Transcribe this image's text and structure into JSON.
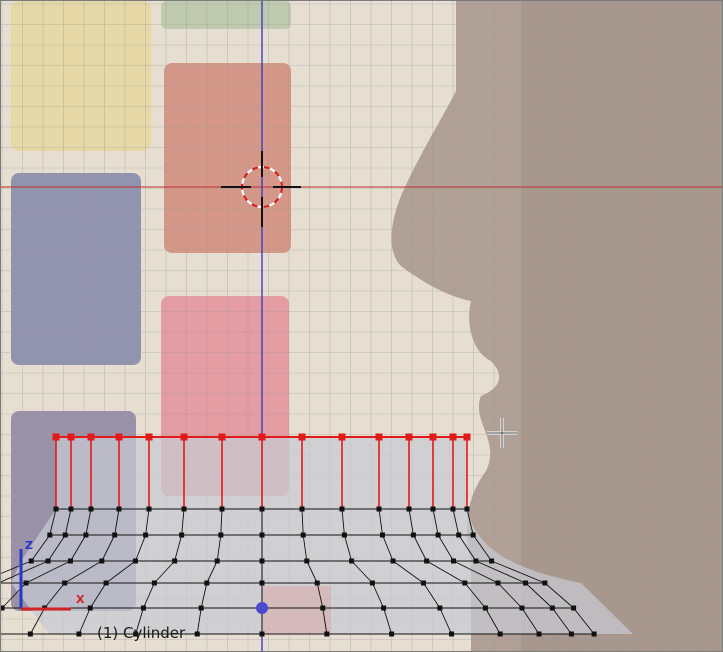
{
  "viewport": {
    "object_label": "(1) Cylinder",
    "axis_labels": {
      "z": "Z",
      "x": "X"
    },
    "icons": {
      "cursor": "3d-cursor-icon",
      "mouse": "crosshair-pointer-icon",
      "gizmo": "axis-gizmo-icon"
    },
    "colors": {
      "selected_vertex": "#e11a1a",
      "vertex": "#111111",
      "grid": "#9a9a9a",
      "x_axis_line": "#c03030",
      "z_axis_line": "#3a3ac8",
      "mesh_fill": "#c9ccd5"
    }
  }
}
